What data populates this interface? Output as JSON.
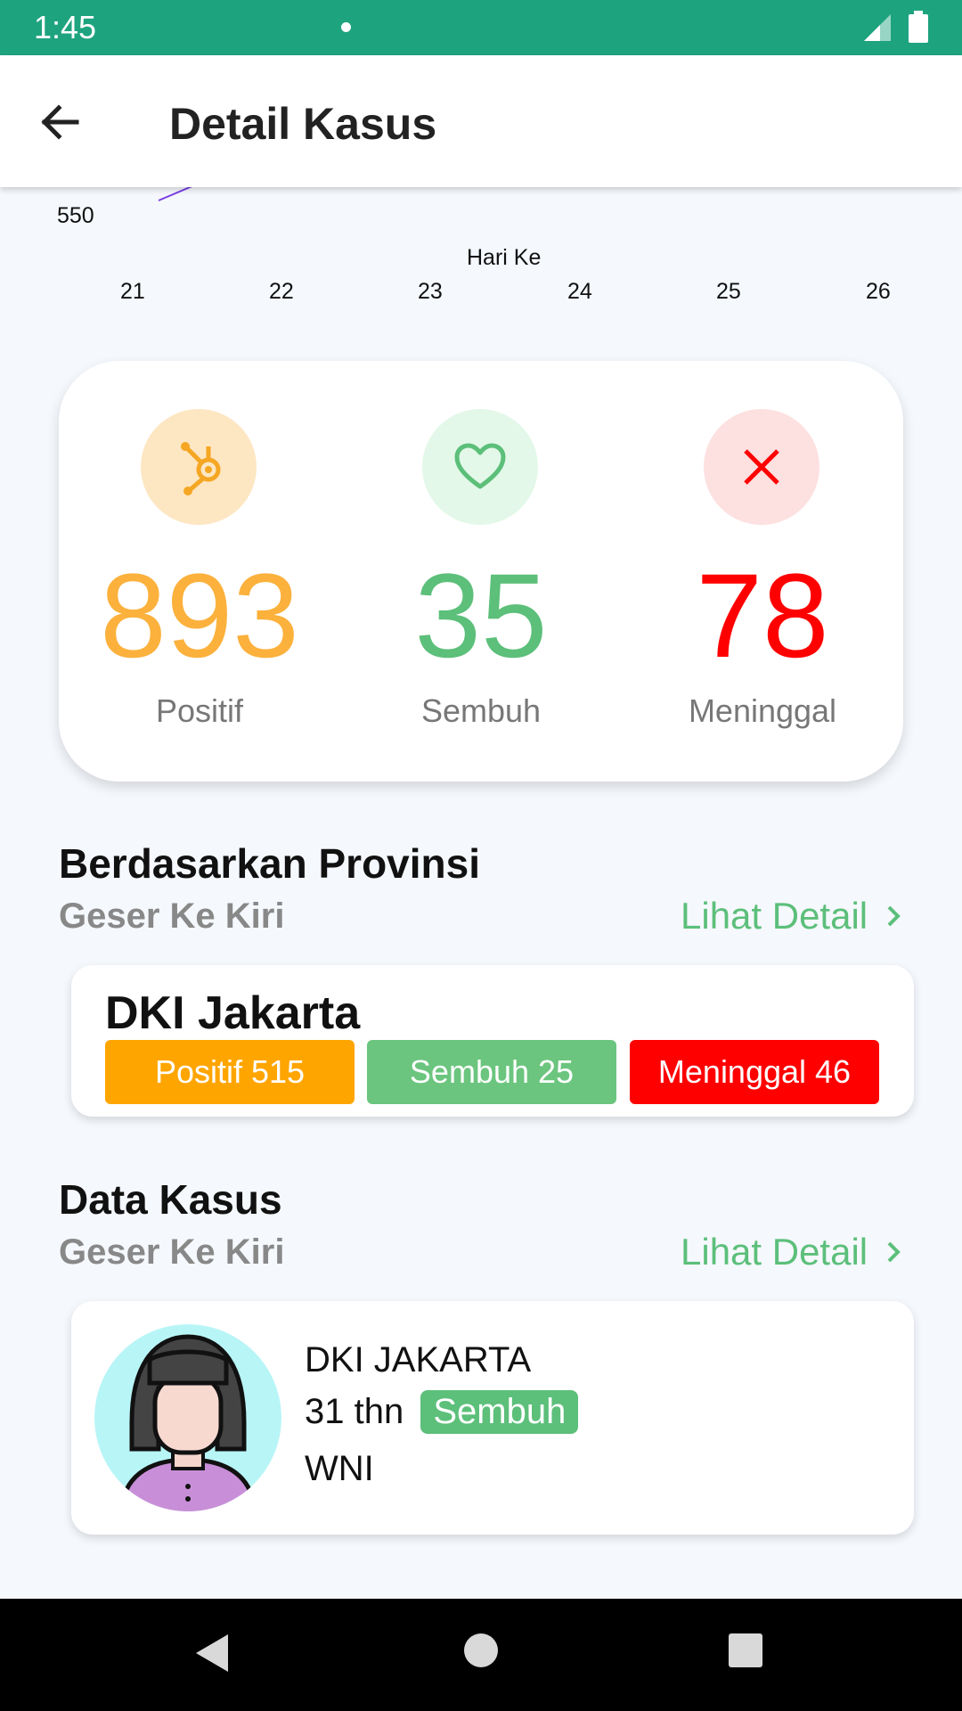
{
  "status_bar": {
    "time": "1:45"
  },
  "app_bar": {
    "title": "Detail Kasus"
  },
  "chart_data": {
    "type": "line",
    "xlabel": "Hari Ke",
    "x_ticks": [
      "21",
      "22",
      "23",
      "24",
      "25",
      "26"
    ],
    "y_ticks": [
      "550"
    ],
    "series_color": "#7b3fe4"
  },
  "summary": [
    {
      "value": "893",
      "label": "Positif",
      "color": "#fbb13c",
      "bg": "#fde6c2",
      "icon": "hub-icon"
    },
    {
      "value": "35",
      "label": "Sembuh",
      "color": "#5cbf7a",
      "bg": "#e3f8e8",
      "icon": "heart-icon"
    },
    {
      "value": "78",
      "label": "Meninggal",
      "color": "#ff0000",
      "bg": "#fde0e0",
      "icon": "close-icon"
    }
  ],
  "province_section": {
    "title": "Berdasarkan Provinsi",
    "subtitle": "Geser Ke Kiri",
    "link": "Lihat Detail",
    "card": {
      "name": "DKI Jakarta",
      "positif": "Positif 515",
      "sembuh": "Sembuh 25",
      "meninggal": "Meninggal 46"
    }
  },
  "case_section": {
    "title": "Data Kasus",
    "subtitle": "Geser Ke Kiri",
    "link": "Lihat Detail",
    "card": {
      "province": "DKI JAKARTA",
      "age": "31 thn",
      "status": "Sembuh",
      "nationality": "WNI"
    }
  },
  "colors": {
    "accent": "#1ea37f",
    "green": "#5cbf7a",
    "orange": "#ffa500",
    "red": "#ff0000"
  }
}
